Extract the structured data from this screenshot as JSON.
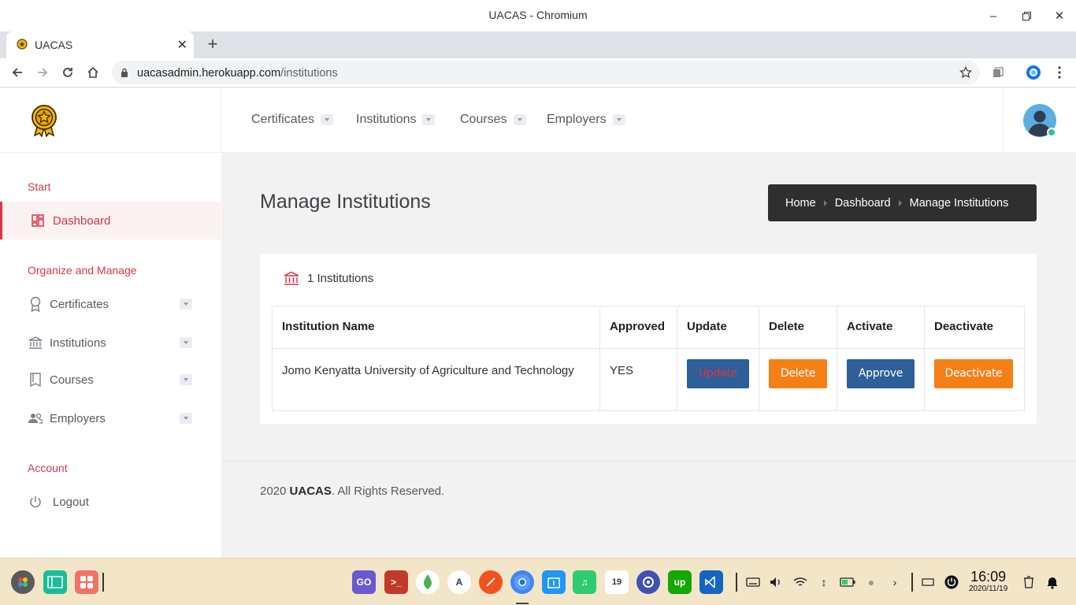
{
  "window": {
    "title": "UACAS - Chromium"
  },
  "browser": {
    "tab_title": "UACAS",
    "url_host": "uacasadmin.herokuapp.com",
    "url_path": "/institutions"
  },
  "topnav": {
    "items": [
      {
        "label": "Certificates"
      },
      {
        "label": "Institutions"
      },
      {
        "label": "Courses"
      },
      {
        "label": "Employers"
      }
    ]
  },
  "sidebar": {
    "start_title": "Start",
    "dashboard_label": "Dashboard",
    "organize_title": "Organize and Manage",
    "items": [
      {
        "label": "Certificates",
        "icon": "award-icon"
      },
      {
        "label": "Institutions",
        "icon": "bank-icon"
      },
      {
        "label": "Courses",
        "icon": "book-icon"
      },
      {
        "label": "Employers",
        "icon": "users-icon"
      }
    ],
    "account_title": "Account",
    "logout_label": "Logout"
  },
  "page": {
    "title": "Manage Institutions",
    "breadcrumb": [
      "Home",
      "Dashboard",
      "Manage Institutions"
    ]
  },
  "card": {
    "count": "1 Institutions",
    "columns": [
      "Institution Name",
      "Approved",
      "Update",
      "Delete",
      "Activate",
      "Deactivate"
    ],
    "rows": [
      {
        "name": "Jomo Kenyatta University of Agriculture and Technology",
        "approved": "YES",
        "update_label": "Update",
        "delete_label": "Delete",
        "activate_label": "Approve",
        "deactivate_label": "Deactivate"
      }
    ]
  },
  "footer": {
    "year": "2020",
    "brand": "UACAS",
    "rights": ". All Rights Reserved."
  },
  "taskbar": {
    "time": "16:09",
    "date": "2020/11/19"
  },
  "colors": {
    "accent": "#dc3545",
    "button_blue": "#2d5f98",
    "button_orange": "#f57f17",
    "breadcrumb_bg": "#2f2f2f"
  }
}
